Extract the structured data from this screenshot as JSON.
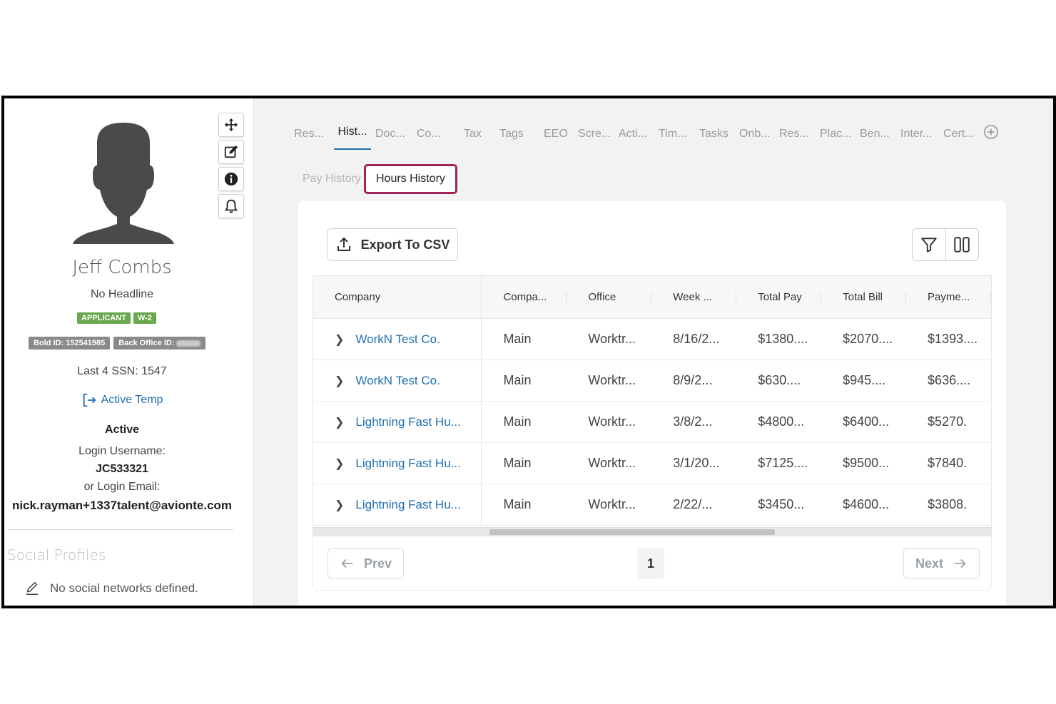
{
  "profile": {
    "name": "Jeff Combs",
    "headline": "No Headline",
    "badges": [
      "APPLICANT",
      "W-2"
    ],
    "bold_id": "Bold ID: 152541985",
    "back_office_id_label": "Back Office ID:",
    "last4": "Last 4 SSN: 1547",
    "status_link": "Active Temp",
    "status": "Active",
    "login_username_label": "Login Username:",
    "login_username": "JC533321",
    "login_email_label": "or Login Email:",
    "login_email": "nick.rayman+1337talent@avionte.com",
    "social_title": "Social Profiles",
    "social_empty": "No social networks defined."
  },
  "tools": [
    "move-icon",
    "edit-icon",
    "info-icon",
    "bell-icon"
  ],
  "tabs": [
    "Res...",
    "Hist...",
    "Doc...",
    "Co...",
    "Tax",
    "Tags",
    "EEO",
    "Scre...",
    "Acti...",
    "Tim...",
    "Tasks",
    "Onb...",
    "Res...",
    "Plac...",
    "Ben...",
    "Inter...",
    "Cert..."
  ],
  "subtabs": {
    "pay": "Pay History",
    "hours": "Hours History"
  },
  "toolbar": {
    "export_label": "Export To CSV"
  },
  "table": {
    "columns": [
      "Company",
      "Compa...",
      "Office",
      "Week ...",
      "Total Pay",
      "Total Bill",
      "Payme..."
    ],
    "rows": [
      [
        "WorkN Test Co.",
        "Main",
        "Worktr...",
        "8/16/2...",
        "$1380....",
        "$2070....",
        "$1393...."
      ],
      [
        "WorkN Test Co.",
        "Main",
        "Worktr...",
        "8/9/2...",
        "$630....",
        "$945....",
        "$636...."
      ],
      [
        "Lightning Fast Hu...",
        "Main",
        "Worktr...",
        "3/8/2...",
        "$4800...",
        "$6400...",
        "$5270."
      ],
      [
        "Lightning Fast Hu...",
        "Main",
        "Worktr...",
        "3/1/20...",
        "$7125....",
        "$9500...",
        "$7840."
      ],
      [
        "Lightning Fast Hu...",
        "Main",
        "Worktr...",
        "2/22/...",
        "$3450...",
        "$4600...",
        "$3808."
      ]
    ]
  },
  "pager": {
    "prev": "Prev",
    "page": "1",
    "next": "Next"
  },
  "colors": {
    "link": "#1f6fb2",
    "highlight": "#a0225a",
    "badge_green": "#6aa84f"
  }
}
